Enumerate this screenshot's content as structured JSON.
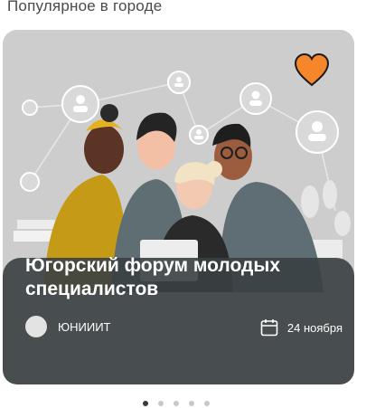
{
  "section": {
    "title": "Популярное в городе"
  },
  "card": {
    "title": "Югорский форум молодых специалистов",
    "organizer": "ЮНИИИТ",
    "date": "24 ноября",
    "favorite_color": "#f5862a",
    "icons": {
      "favorite": "heart-icon",
      "date": "calendar-icon"
    }
  },
  "pagination": {
    "count": 5,
    "active": 1
  }
}
